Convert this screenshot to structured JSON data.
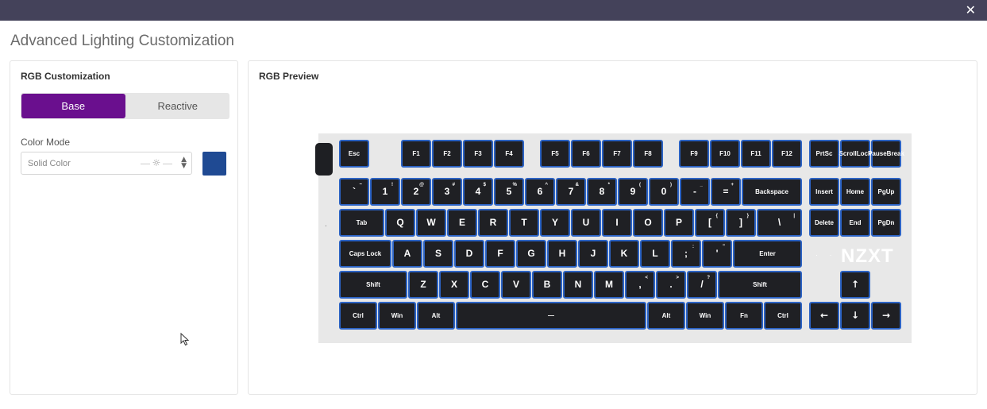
{
  "window": {
    "close_glyph": "✕"
  },
  "page": {
    "title": "Advanced Lighting Customization"
  },
  "left_panel": {
    "title": "RGB Customization",
    "tabs": [
      {
        "label": "Base",
        "active": true
      },
      {
        "label": "Reactive",
        "active": false
      }
    ],
    "color_mode": {
      "label": "Color Mode",
      "value": "Solid Color",
      "icon": "brightness-icon"
    },
    "swatch_color": "#1f4a93"
  },
  "right_panel": {
    "title": "RGB Preview",
    "logo": "NZXT",
    "logo_dots": "· ·",
    "edge_dot": "·",
    "backlight_color": "#2c63c4"
  },
  "keys": {
    "esc": "Esc",
    "f1": "F1",
    "f2": "F2",
    "f3": "F3",
    "f4": "F4",
    "f5": "F5",
    "f6": "F6",
    "f7": "F7",
    "f8": "F8",
    "f9": "F9",
    "f10": "F10",
    "f11": "F11",
    "f12": "F12",
    "prtsc": "PrtSc",
    "scroll_1": "Scroll",
    "scroll_2": "Lock",
    "pause_1": "Pause",
    "pause_2": "Break",
    "grave": "`",
    "grave_s": "~",
    "n1": "1",
    "n1_s": "!",
    "n2": "2",
    "n2_s": "@",
    "n3": "3",
    "n3_s": "#",
    "n4": "4",
    "n4_s": "$",
    "n5": "5",
    "n5_s": "%",
    "n6": "6",
    "n6_s": "^",
    "n7": "7",
    "n7_s": "&",
    "n8": "8",
    "n8_s": "*",
    "n9": "9",
    "n9_s": "(",
    "n0": "0",
    "n0_s": ")",
    "minus": "-",
    "minus_s": "_",
    "equal": "=",
    "equal_s": "+",
    "backspace": "Backspace",
    "insert": "Insert",
    "home": "Home",
    "pgup": "PgUp",
    "tab": "Tab",
    "q": "Q",
    "w": "W",
    "e": "E",
    "r": "R",
    "t": "T",
    "y": "Y",
    "u": "U",
    "i": "I",
    "o": "O",
    "p": "P",
    "lbracket": "[",
    "lbracket_s": "{",
    "rbracket": "]",
    "rbracket_s": "}",
    "backslash": "\\",
    "backslash_s": "|",
    "delete": "Delete",
    "end": "End",
    "pgdn": "PgDn",
    "caps": "Caps Lock",
    "a": "A",
    "s": "S",
    "d": "D",
    "f": "F",
    "g": "G",
    "h": "H",
    "j": "J",
    "k": "K",
    "l": "L",
    "semicolon": ";",
    "semicolon_s": ":",
    "quote": "'",
    "quote_s": "\"",
    "enter": "Enter",
    "lshift": "Shift",
    "z": "Z",
    "x": "X",
    "c": "C",
    "v": "V",
    "b": "B",
    "n": "N",
    "m": "M",
    "comma": ",",
    "comma_s": "<",
    "period": ".",
    "period_s": ">",
    "slash": "/",
    "slash_s": "?",
    "rshift": "Shift",
    "up": "↑",
    "lctrl": "Ctrl",
    "lwin": "Win",
    "lalt": "Alt",
    "space": "—",
    "ralt": "Alt",
    "rwin": "Win",
    "fn": "Fn",
    "rctrl": "Ctrl",
    "left": "←",
    "down": "↓",
    "right": "→"
  }
}
